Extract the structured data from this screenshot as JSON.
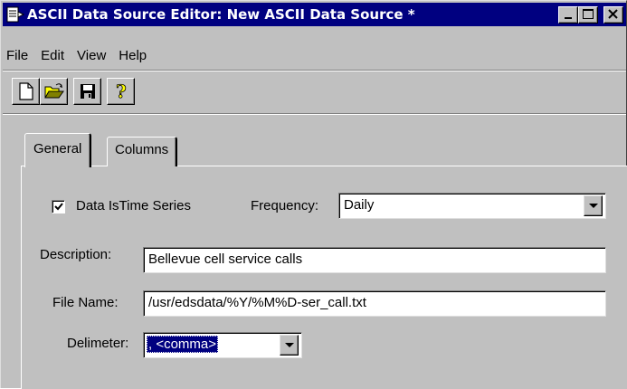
{
  "window": {
    "title": "ASCII Data Source Editor: New ASCII Data Source *"
  },
  "menu": {
    "items": [
      "File",
      "Edit",
      "View",
      "Help"
    ]
  },
  "toolbar": {
    "buttons": [
      "new-icon",
      "open-icon",
      "save-icon",
      "help-icon"
    ]
  },
  "tabs": [
    "General",
    "Columns"
  ],
  "form": {
    "time_series_label": "Data IsTime Series",
    "time_series_checked": true,
    "frequency_label": "Frequency:",
    "frequency_value": "Daily",
    "description_label": "Description:",
    "description_value": "Bellevue cell service calls",
    "file_name_label": "File Name:",
    "file_name_value": "/usr/edsdata/%Y/%M%D-ser_call.txt",
    "delimiter_label": "Delimeter:",
    "delimiter_value": ", <comma>"
  },
  "colors": {
    "titlebar": "#000080",
    "face": "#c0c0c0",
    "selection": "#000080"
  }
}
